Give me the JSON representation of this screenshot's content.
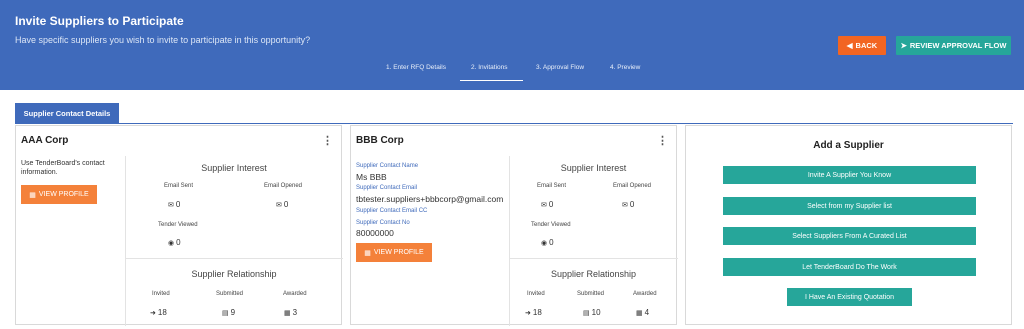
{
  "header": {
    "title": "Invite Suppliers to Participate",
    "subtitle": "Have specific suppliers you wish to invite to participate in this opportunity?",
    "back_label": "BACK",
    "review_label": "REVIEW APPROVAL FLOW",
    "steps": [
      "1. Enter RFQ Details",
      "2. Invitations",
      "3. Approval Flow",
      "4. Preview"
    ],
    "active_step": 2
  },
  "tab_label": "Supplier Contact Details",
  "labels": {
    "interest": "Supplier Interest",
    "relationship": "Supplier Relationship",
    "email_sent": "Email Sent",
    "email_opened": "Email Opened",
    "tender_viewed": "Tender Viewed",
    "invited": "Invited",
    "submitted": "Submitted",
    "awarded": "Awarded",
    "view_profile": "VIEW PROFILE",
    "contact_name": "Supplier Contact Name",
    "contact_email": "Supplier Contact Email",
    "contact_email_cc": "Supplier Contact Email CC",
    "contact_no": "Supplier Contact No"
  },
  "cards": [
    {
      "name": "AAA Corp",
      "info": "Use TenderBoard's contact information.",
      "email_sent": "0",
      "email_opened": "0",
      "tender_viewed": "0",
      "invited": "18",
      "submitted": "9",
      "awarded": "3"
    },
    {
      "name": "BBB Corp",
      "contact_name": "Ms BBB",
      "contact_email": "tbtester.suppliers+bbbcorp@gmail.com",
      "contact_no": "80000000",
      "email_sent": "0",
      "email_opened": "0",
      "tender_viewed": "0",
      "invited": "18",
      "submitted": "10",
      "awarded": "4"
    }
  ],
  "add_supplier": {
    "title": "Add a Supplier",
    "buttons": [
      "Invite A Supplier You Know",
      "Select from my Supplier list",
      "Select Suppliers From A Curated List",
      "Let TenderBoard Do The Work",
      "I Have An Existing Quotation"
    ]
  },
  "colors": {
    "header_blue": "#3f6abb",
    "orange": "#f26522",
    "teal": "#26a69a",
    "profile_orange": "#f4813a"
  },
  "icons": {
    "back": "arrow-left-icon",
    "review": "arrow-right-icon",
    "email_sent": "envelope-icon",
    "email_opened": "envelope-open-icon",
    "tender_viewed": "eye-icon",
    "invited": "sign-in-icon",
    "submitted": "book-icon",
    "awarded": "gift-icon",
    "view_profile": "building-icon",
    "menu": "kebab-menu-icon"
  }
}
